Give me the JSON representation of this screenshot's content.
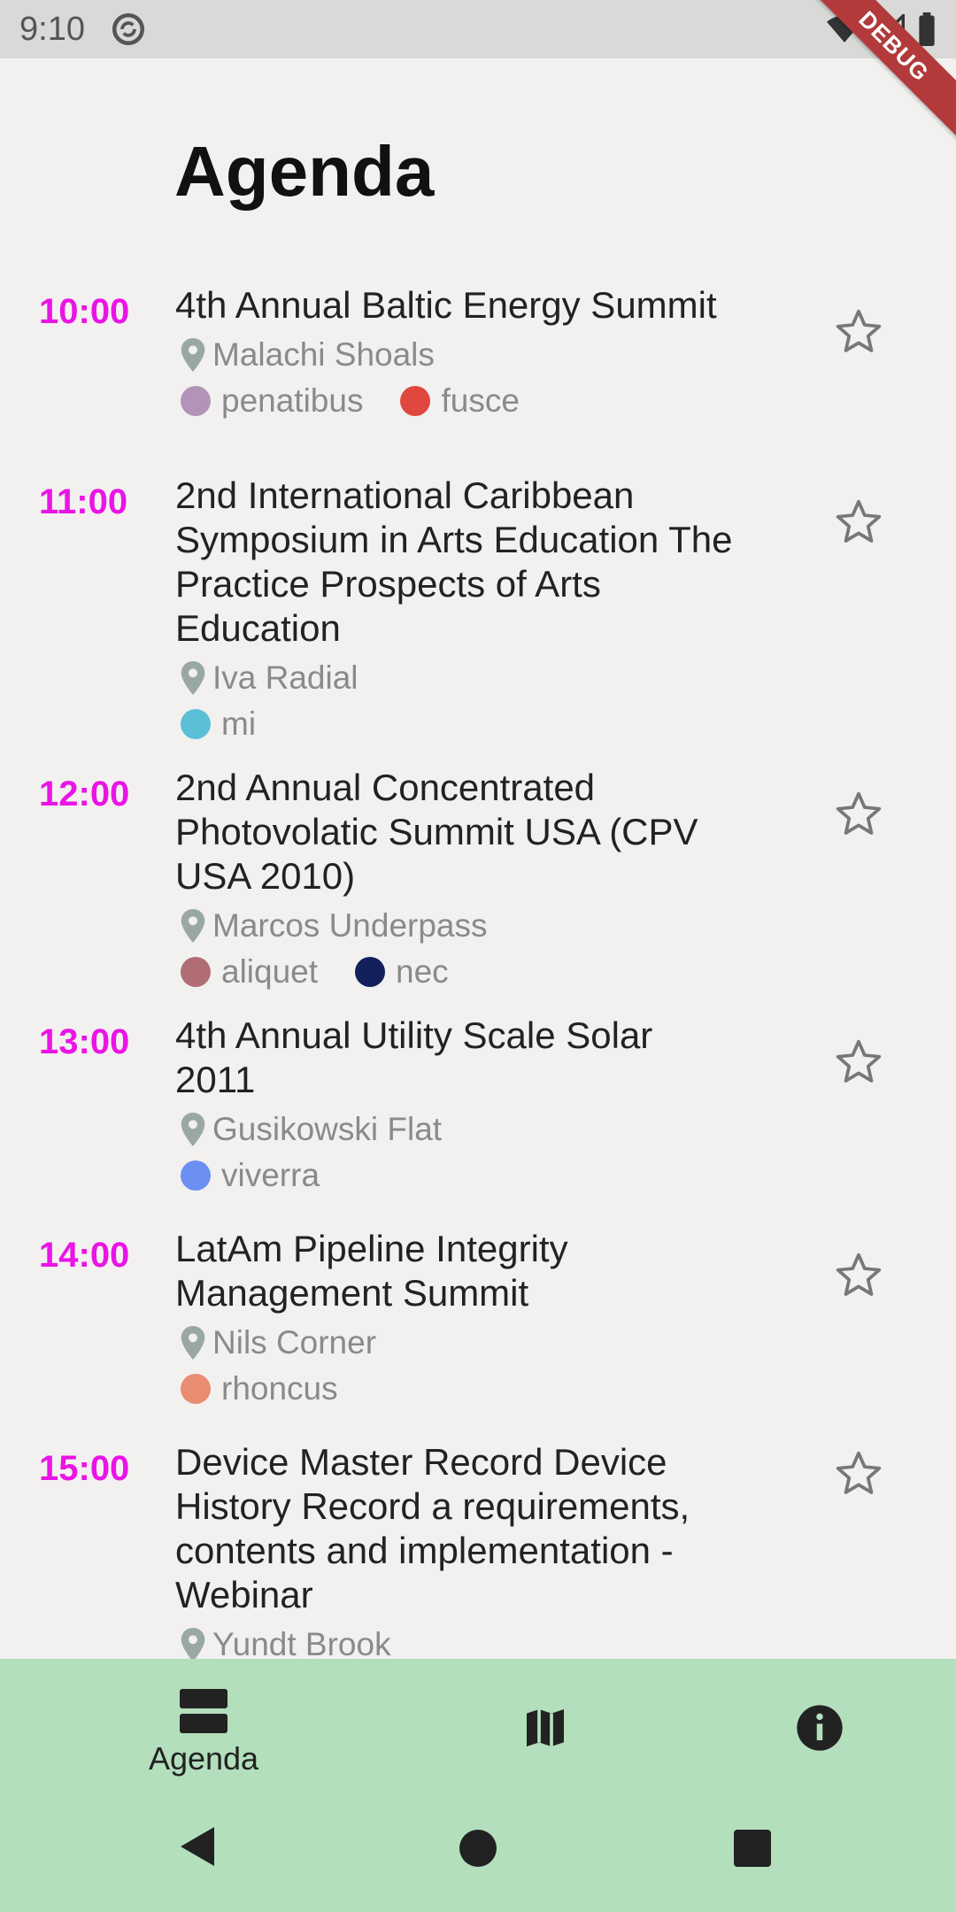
{
  "status_bar": {
    "time": "9:10",
    "debug_label": "DEBUG",
    "icons": [
      "sync-icon",
      "wifi-icon",
      "signal-icon",
      "battery-icon"
    ]
  },
  "page": {
    "title": "Agenda"
  },
  "colors": {
    "time": "#ea14e6",
    "background": "#f2f1ef",
    "nav_background": "#b4dfbc",
    "debug": "#b23a3a"
  },
  "items": [
    {
      "time": "10:00",
      "title": "4th Annual Baltic Energy Summit",
      "location": "Malachi Shoals",
      "tags": [
        {
          "label": "penatibus",
          "color": "#b194b7"
        },
        {
          "label": "fusce",
          "color": "#e0473f"
        }
      ]
    },
    {
      "time": "11:00",
      "title": "2nd International Caribbean Symposium in Arts Education The Practice Prospects of Arts Education",
      "location": "Iva Radial",
      "tags": [
        {
          "label": "mi",
          "color": "#5bc0d6"
        }
      ]
    },
    {
      "time": "12:00",
      "title": "2nd Annual Concentrated Photovolatic Summit USA (CPV USA 2010)",
      "location": "Marcos Underpass",
      "tags": [
        {
          "label": "aliquet",
          "color": "#b06e74"
        },
        {
          "label": "nec",
          "color": "#14205c"
        }
      ]
    },
    {
      "time": "13:00",
      "title": "4th Annual Utility Scale Solar 2011",
      "location": "Gusikowski Flat",
      "tags": [
        {
          "label": "viverra",
          "color": "#6b8ff2"
        }
      ]
    },
    {
      "time": "14:00",
      "title": "LatAm Pipeline Integrity Management Summit",
      "location": "Nils Corner",
      "tags": [
        {
          "label": "rhoncus",
          "color": "#ea8c70"
        }
      ]
    },
    {
      "time": "15:00",
      "title": "Device Master Record Device History Record a requirements, contents and implementation - Webinar",
      "location": "Yundt Brook",
      "tags": []
    }
  ],
  "bottom_nav": {
    "items": [
      {
        "label": "Agenda",
        "icon": "agenda-icon",
        "selected": true
      },
      {
        "label": "",
        "icon": "map-icon",
        "selected": false
      },
      {
        "label": "",
        "icon": "info-icon",
        "selected": false
      }
    ]
  },
  "system_nav": {
    "icons": [
      "back-icon",
      "home-icon",
      "recents-icon"
    ]
  }
}
